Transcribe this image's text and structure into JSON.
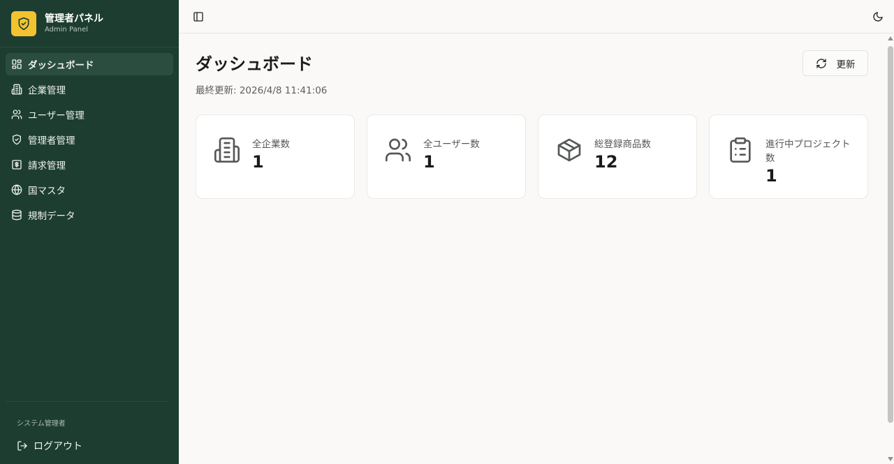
{
  "brand": {
    "title": "管理者パネル",
    "subtitle": "Admin Panel",
    "logo_icon": "shield-check-icon",
    "logo_color": "#f2c230"
  },
  "sidebar": {
    "items": [
      {
        "label": "ダッシュボード",
        "icon": "dashboard-grid-icon",
        "active": true
      },
      {
        "label": "企業管理",
        "icon": "building-icon",
        "active": false
      },
      {
        "label": "ユーザー管理",
        "icon": "users-icon",
        "active": false
      },
      {
        "label": "管理者管理",
        "icon": "shield-check-icon",
        "active": false
      },
      {
        "label": "請求管理",
        "icon": "receipt-dollar-icon",
        "active": false
      },
      {
        "label": "国マスタ",
        "icon": "globe-icon",
        "active": false
      },
      {
        "label": "規制データ",
        "icon": "database-icon",
        "active": false
      }
    ],
    "role_label": "システム管理者",
    "logout_label": "ログアウト"
  },
  "colors": {
    "sidebar_bg": "#1d3d31",
    "sidebar_active": "#2b4d40",
    "main_bg": "#faf9f7",
    "card_bg": "#ffffff"
  },
  "main": {
    "title": "ダッシュボード",
    "last_updated": "最終更新: 2026/4/8 11:41:06",
    "refresh_label": "更新"
  },
  "stats": [
    {
      "label": "全企業数",
      "value": "1",
      "icon": "building-icon"
    },
    {
      "label": "全ユーザー数",
      "value": "1",
      "icon": "users-icon"
    },
    {
      "label": "総登録商品数",
      "value": "12",
      "icon": "package-icon"
    },
    {
      "label": "進行中プロジェクト数",
      "value": "1",
      "icon": "clipboard-list-icon"
    }
  ]
}
